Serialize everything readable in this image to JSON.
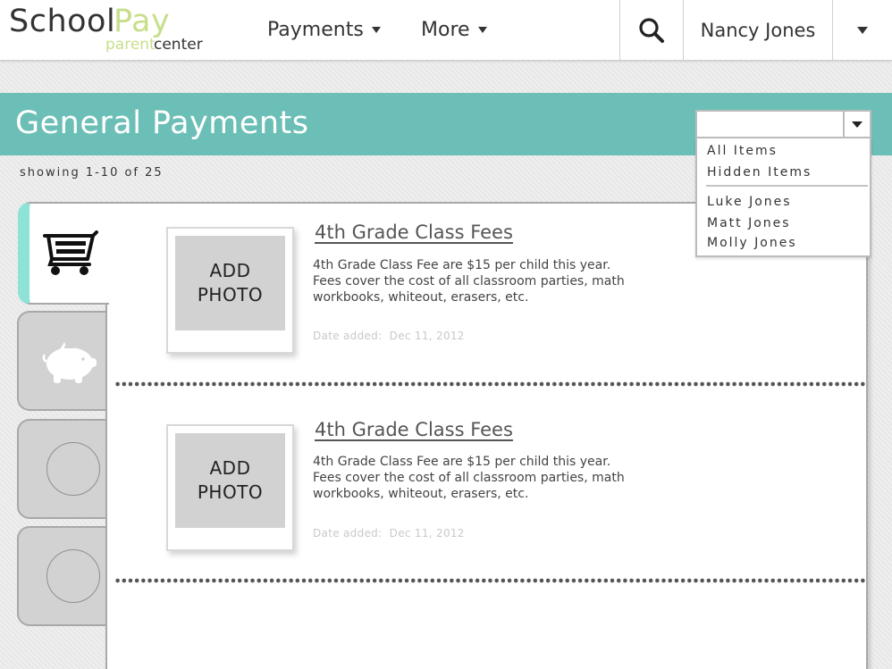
{
  "brand": {
    "school": "School",
    "pay": "Pay",
    "parent": "parent",
    "center": "center",
    "accent": "#c7df8a"
  },
  "nav": {
    "payments_label": "Payments",
    "more_label": "More",
    "user_name": "Nancy Jones",
    "icons": {
      "search": "search-icon",
      "dropdown": "chevron-down-icon"
    }
  },
  "header": {
    "title": "General Payments",
    "band_color": "#6cbfb6"
  },
  "filter": {
    "selected": "",
    "options": [
      "All Items",
      "Hidden Items",
      "Luke Jones",
      "Matt Jones",
      "Molly Jones"
    ]
  },
  "listing": {
    "showing": "showing 1-10 of 25"
  },
  "tabs": [
    {
      "icon": "shopping-cart-icon",
      "active": true
    },
    {
      "icon": "piggy-bank-icon",
      "active": false
    },
    {
      "icon": "circle-icon",
      "active": false
    },
    {
      "icon": "circle-icon",
      "active": false
    }
  ],
  "items": [
    {
      "photo_line1": "ADD",
      "photo_line2": "PHOTO",
      "title": "4th Grade Class Fees",
      "description": "4th Grade Class Fee are $15 per child this year.\nFees cover the cost of all classroom parties, math\n workbooks, whiteout, erasers, etc.",
      "date_label": "Date added:",
      "date": "Dec 11, 2012"
    },
    {
      "photo_line1": "ADD",
      "photo_line2": "PHOTO",
      "title": "4th Grade Class Fees",
      "description": "4th Grade Class Fee are $15 per child this year.\nFees cover the cost of all classroom parties, math\n workbooks, whiteout, erasers, etc.",
      "date_label": "Date added:",
      "date": "Dec 11, 2012"
    }
  ]
}
